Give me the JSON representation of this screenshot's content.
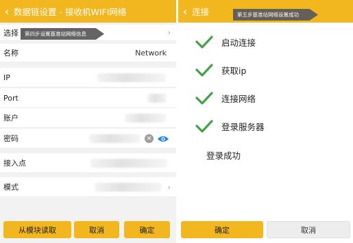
{
  "left": {
    "header": {
      "back_icon": "‹",
      "title": "数据链设置 - 接收机WIFI网络"
    },
    "tooltip": "第四步设置基准站网络信息",
    "rows": {
      "select_saved": "选择 服务器",
      "name_label": "名称",
      "name_value": "Network",
      "ip_label": "IP",
      "port_label": "Port",
      "account_label": "账户",
      "password_label": "密码",
      "access_point_label": "接入点",
      "mode_label": "模式"
    },
    "buttons": {
      "read_module": "从模块读取",
      "cancel": "取消",
      "confirm": "确定"
    },
    "colors": {
      "accent": "#f2b61e",
      "eye": "#1e88e5"
    }
  },
  "right": {
    "header": {
      "back_icon": "‹",
      "title": "连接"
    },
    "tooltip": "第五步基准站网络设置成功",
    "steps": [
      {
        "label": "启动连接",
        "done": true
      },
      {
        "label": "获取ip",
        "done": true
      },
      {
        "label": "连接网络",
        "done": true
      },
      {
        "label": "登录服务器",
        "done": true
      }
    ],
    "status": "登录成功",
    "buttons": {
      "confirm": "确定",
      "cancel": "取消"
    },
    "colors": {
      "check": "#43a047"
    }
  }
}
